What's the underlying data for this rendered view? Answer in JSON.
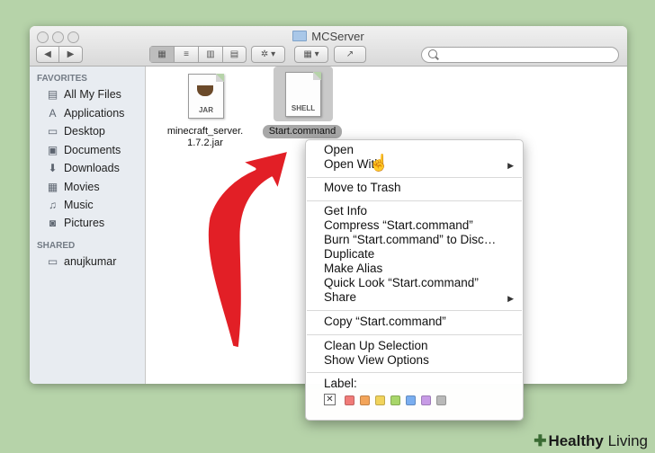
{
  "window": {
    "title": "MCServer",
    "toolbar": {
      "back": "◀",
      "forward": "▶",
      "view_icons": "▦",
      "view_list": "≡",
      "view_columns": "▥",
      "view_coverflow": "▤",
      "action": "✲ ▾",
      "arrange": "▦ ▾",
      "share": "↗"
    }
  },
  "sidebar": {
    "favorites_heading": "FAVORITES",
    "shared_heading": "SHARED",
    "favorites": [
      {
        "label": "All My Files",
        "icon": "▤"
      },
      {
        "label": "Applications",
        "icon": "A"
      },
      {
        "label": "Desktop",
        "icon": "▭"
      },
      {
        "label": "Documents",
        "icon": "▣"
      },
      {
        "label": "Downloads",
        "icon": "⬇"
      },
      {
        "label": "Movies",
        "icon": "▦"
      },
      {
        "label": "Music",
        "icon": "♫"
      },
      {
        "label": "Pictures",
        "icon": "◙"
      }
    ],
    "shared": [
      {
        "label": "anujkumar",
        "icon": "▭"
      }
    ]
  },
  "files": [
    {
      "name_line1": "minecraft_server.",
      "name_line2": "1.7.2.jar",
      "tag": "JAR",
      "icon": "jar-file-icon"
    },
    {
      "name_line1": "Start.command",
      "tag": "SHELL",
      "icon": "shell-file-icon"
    }
  ],
  "context_menu": {
    "open": "Open",
    "open_with": "Open With",
    "move_to_trash": "Move to Trash",
    "get_info": "Get Info",
    "compress": "Compress “Start.command”",
    "burn": "Burn “Start.command” to Disc…",
    "duplicate": "Duplicate",
    "make_alias": "Make Alias",
    "quick_look": "Quick Look “Start.command”",
    "share": "Share",
    "copy": "Copy “Start.command”",
    "clean_up": "Clean Up Selection",
    "show_view_options": "Show View Options",
    "label_heading": "Label:",
    "label_colors": [
      "#f07b78",
      "#f3a45a",
      "#f1d35c",
      "#a8d66a",
      "#7aaef0",
      "#c79be6",
      "#b9b9b9"
    ],
    "label_none": "✕"
  },
  "watermark": {
    "plus": "✚",
    "bold": "Healthy",
    "regular": " Living"
  }
}
